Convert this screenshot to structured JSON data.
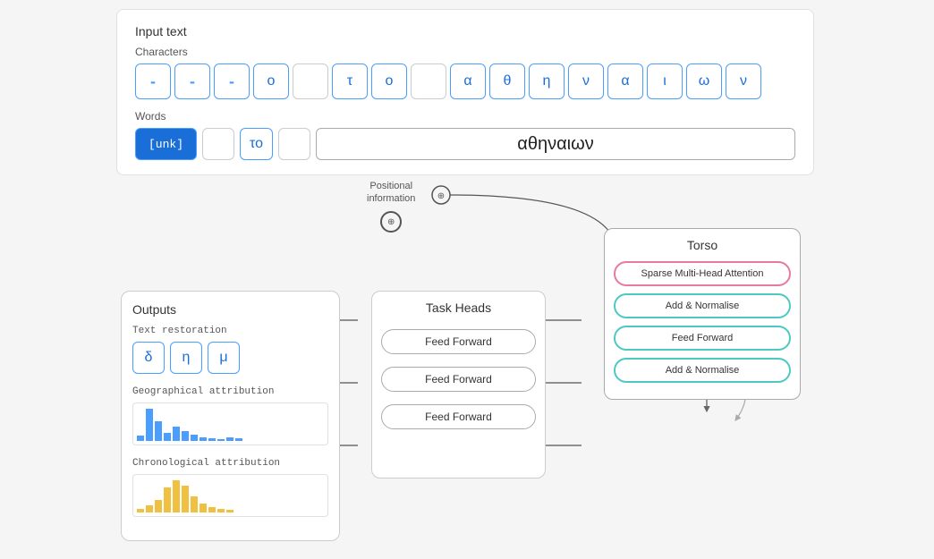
{
  "header": {
    "input_text_label": "Input text",
    "characters_label": "Characters",
    "words_label": "Words"
  },
  "characters": [
    {
      "value": "-",
      "type": "dash"
    },
    {
      "value": "-",
      "type": "dash"
    },
    {
      "value": "-",
      "type": "dash"
    },
    {
      "value": "ο",
      "type": "normal"
    },
    {
      "value": "",
      "type": "empty"
    },
    {
      "value": "τ",
      "type": "normal"
    },
    {
      "value": "ο",
      "type": "normal"
    },
    {
      "value": "",
      "type": "empty"
    },
    {
      "value": "α",
      "type": "normal"
    },
    {
      "value": "θ",
      "type": "normal"
    },
    {
      "value": "η",
      "type": "normal"
    },
    {
      "value": "ν",
      "type": "normal"
    },
    {
      "value": "α",
      "type": "normal"
    },
    {
      "value": "ι",
      "type": "normal"
    },
    {
      "value": "ω",
      "type": "normal"
    },
    {
      "value": "ν",
      "type": "normal"
    }
  ],
  "words": [
    {
      "value": "[unk]",
      "type": "unk"
    },
    {
      "value": "",
      "type": "small-empty"
    },
    {
      "value": "το",
      "type": "to"
    },
    {
      "value": "",
      "type": "small-empty"
    },
    {
      "value": "αθηναιων",
      "type": "large"
    }
  ],
  "diagram": {
    "positional_info_label": "Positional\ninformation",
    "torso_title": "Torso",
    "smha_label": "Sparse Multi-Head\nAttention",
    "add_norm_label_1": "Add & Normalise",
    "ff_torso_label": "Feed Forward",
    "add_norm_label_2": "Add & Normalise",
    "task_heads_title": "Task Heads",
    "ff_task_1": "Feed Forward",
    "ff_task_2": "Feed Forward",
    "ff_task_3": "Feed Forward",
    "outputs_title": "Outputs",
    "text_restoration_label": "Text restoration",
    "text_restoration_chars": [
      "δ",
      "η",
      "μ"
    ],
    "geo_label": "Geographical attribution",
    "chron_label": "Chronological attribution"
  },
  "geo_bars": [
    5,
    32,
    20,
    8,
    14,
    10,
    6,
    4,
    3,
    2,
    4,
    3
  ],
  "chron_bars": [
    4,
    8,
    14,
    28,
    36,
    30,
    18,
    10,
    6,
    4,
    3
  ]
}
